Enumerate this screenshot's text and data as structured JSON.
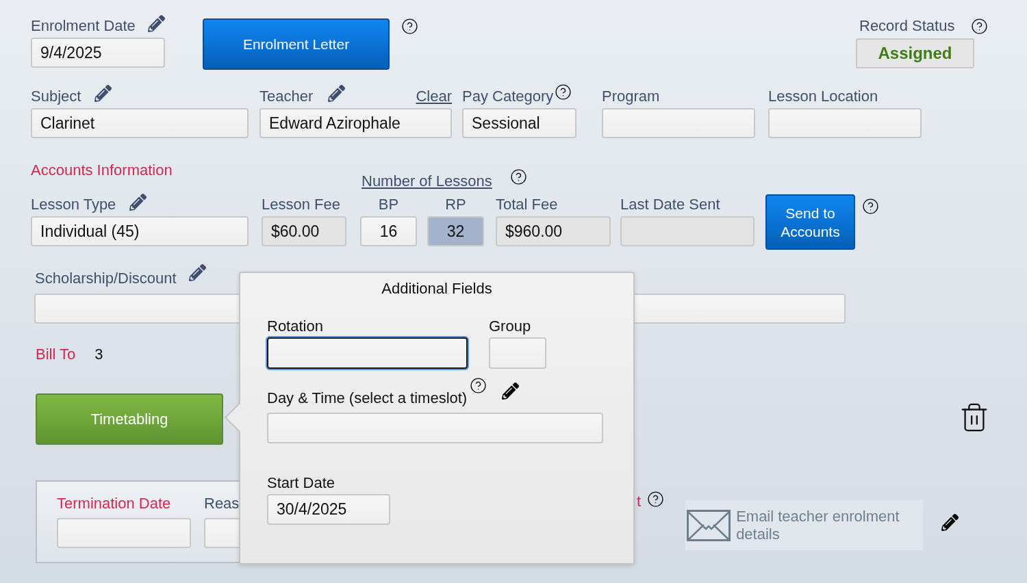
{
  "enrolment_date": {
    "label": "Enrolment Date",
    "value": "9/4/2025"
  },
  "enrolment_letter_button": "Enrolment Letter",
  "record_status": {
    "label": "Record Status",
    "value": "Assigned"
  },
  "details": [
    {
      "label": "Subject",
      "value": "Clarinet"
    },
    {
      "label": "Teacher",
      "value": "Edward Azirophale",
      "link": "Clear"
    },
    {
      "label": "Pay Category",
      "value": "Sessional"
    },
    {
      "label": "Program"
    },
    {
      "label": "Lesson Location"
    }
  ],
  "accounts": {
    "heading": "Accounts Information",
    "lessons_link": "Number of Lessons",
    "fields": [
      {
        "label": "Lesson Type",
        "value": "Individual (45)",
        "readonly": false,
        "highlighted": false
      },
      {
        "label": "Lesson Fee",
        "value": "$60.00",
        "readonly": true,
        "highlighted": false
      },
      {
        "label": "BP",
        "value": "16",
        "readonly": false,
        "highlighted": false
      },
      {
        "label": "RP",
        "value": "32",
        "readonly": false,
        "highlighted": true
      },
      {
        "label": "Total Fee",
        "value": "$960.00",
        "readonly": true,
        "highlighted": false
      },
      {
        "label": "Last Date Sent",
        "readonly": true,
        "highlighted": false
      }
    ],
    "send_button": "Send to Accounts"
  },
  "scholarship": {
    "label": "Scholarship/Discount"
  },
  "bill_to": {
    "label": "Bill To",
    "value": "3"
  },
  "timetabling_button": "Timetabling",
  "termination": {
    "date_label": "Termination Date",
    "reason_label": "Reas"
  },
  "partial_label": "t",
  "email_button": "Email teacher enrolment details",
  "popover": {
    "title": "Additional Fields",
    "rotation": {
      "label": "Rotation",
      "focused": true
    },
    "group": {
      "label": "Group",
      "focused": false
    },
    "day_time": {
      "label": "Day & Time (select a timeslot)",
      "focused": false
    },
    "start_date": {
      "label": "Start Date",
      "value": "30/4/2025",
      "focused": false
    }
  }
}
